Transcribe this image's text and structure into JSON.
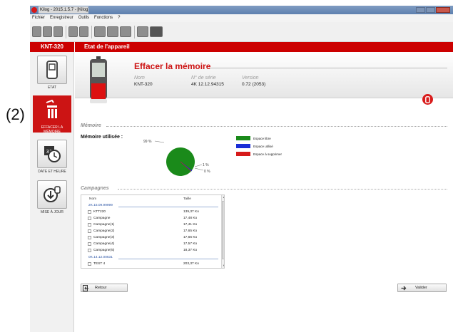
{
  "annotation": "(2)",
  "window": {
    "title": "Kilog - 2015.1.5.7 - [Kilog]"
  },
  "menu": [
    "Fichier",
    "Enregistreur",
    "Outils",
    "Fonctions",
    "?"
  ],
  "sidebar": {
    "header": "KNT-320",
    "items": [
      {
        "label": "ETAT",
        "icon": "logger-device-icon",
        "active": false
      },
      {
        "label": "EFFACER LA MÉMOIRE",
        "icon": "trash-erase-icon",
        "active": true
      },
      {
        "label": "DATE ET HEURE",
        "icon": "calendar-clock-icon",
        "active": false
      },
      {
        "label": "MISE À JOUR",
        "icon": "download-update-icon",
        "active": false
      }
    ]
  },
  "main": {
    "header": "Etat de l'appareil",
    "title": "Effacer la mémoire",
    "info": {
      "nom_label": "Nom",
      "nom_value": "KNT-320",
      "serie_label": "N° de série",
      "serie_value": "4K 12.12.94315",
      "version_label": "Version",
      "version_value": "0.72 (2053)"
    }
  },
  "memory": {
    "section": "Mémoire",
    "used_label": "Mémoire utilisée :",
    "pct_free_label": "99 %",
    "pct_used_label": "1 %",
    "pct_delete_label": "0 %",
    "legend": [
      {
        "label": "Espace libre",
        "color": "#1a8a1a"
      },
      {
        "label": "Espace utilisé",
        "color": "#1a2ed6"
      },
      {
        "label": "Espace à supprimer",
        "color": "#d61a1a"
      }
    ]
  },
  "chart_data": {
    "type": "pie",
    "slices": [
      {
        "label": "Espace libre",
        "value": 99,
        "color": "#1a8a1a"
      },
      {
        "label": "Espace utilisé",
        "value": 1,
        "color": "#1a2ed6"
      },
      {
        "label": "Espace à supprimer",
        "value": 0,
        "color": "#d61a1a"
      }
    ]
  },
  "campaigns": {
    "section": "Campagnes",
    "col_name": "Nom",
    "col_size": "Taille",
    "groups": [
      {
        "name": "2K.15.09.99999",
        "rows": [
          {
            "name": "KTT220",
            "size": "139,37 Ko"
          },
          {
            "name": "Campagne",
            "size": "17,48 Ko"
          },
          {
            "name": "Campagne(1)",
            "size": "17,41 Ko"
          },
          {
            "name": "Campagne(2)",
            "size": "17,65 Ko"
          },
          {
            "name": "Campagne(3)",
            "size": "17,66 Ko"
          },
          {
            "name": "Campagne(4)",
            "size": "17,57 Ko"
          },
          {
            "name": "Campagne(5)",
            "size": "18,37 Ko"
          }
        ]
      },
      {
        "name": "0K.14.12.00631",
        "rows": [
          {
            "name": "TEST 4",
            "size": "203,37 Ko"
          }
        ]
      }
    ]
  },
  "buttons": {
    "back": "Retour",
    "validate": "Valider"
  }
}
